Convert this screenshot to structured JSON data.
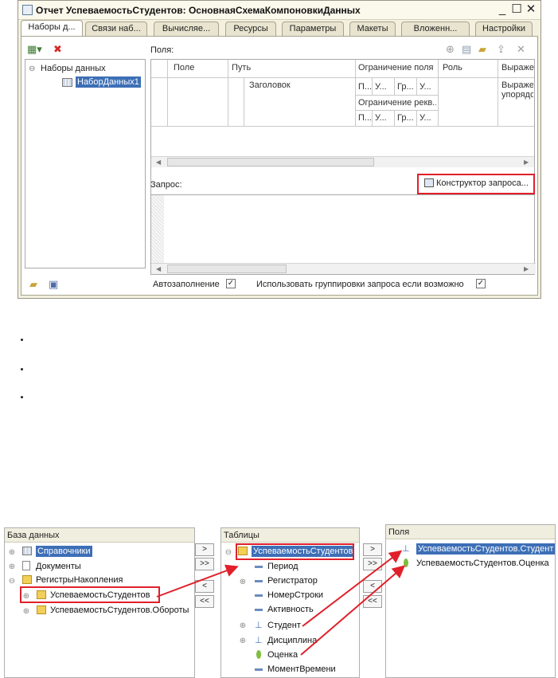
{
  "window": {
    "title": "Отчет УспеваемостьСтудентов: ОсновнаяСхемаКомпоновкиДанных",
    "controls": {
      "minimize": "_",
      "maximize": "☐",
      "close": "✕"
    }
  },
  "tabs": [
    "Наборы д...",
    "Связи наб...",
    "Вычисляе...",
    "Ресурсы",
    "Параметры",
    "Макеты",
    "Вложенн...",
    "Настройки"
  ],
  "tree": {
    "root": "Наборы данных",
    "child": "НаборДанных1"
  },
  "fields": {
    "label": "Поля:",
    "columns": [
      "Поле",
      "Путь",
      "Ограничение поля",
      "Роль",
      "Выраже"
    ],
    "path_value": "Заголовок",
    "restriction_cells": [
      "П...",
      "У...",
      "Гр...",
      "У..."
    ],
    "restriction_req": "Ограничение рекв...",
    "expr_value": "Выраже упорядо"
  },
  "query": {
    "label": "Запрос:",
    "builder_button": "Конструктор запроса..."
  },
  "bottom_bar": {
    "autofill": "Автозаполнение",
    "use_grouping": "Использовать группировки запроса если возможно"
  },
  "builder": {
    "db_header": "База данных",
    "db_items": [
      "Справочники",
      "Документы",
      "РегистрыНакопления",
      "УспеваемостьСтудентов",
      "УспеваемостьСтудентов.Обороты"
    ],
    "tables_header": "Таблицы",
    "table_root": "УспеваемостьСтудентов",
    "table_fields": [
      "Период",
      "Регистратор",
      "НомерСтроки",
      "Активность",
      "Студент",
      "Дисциплина",
      "Оценка",
      "МоментВремени"
    ],
    "fields_header": "Поля",
    "selected_fields": [
      "УспеваемостьСтудентов.Студент",
      "УспеваемостьСтудентов.Оценка"
    ],
    "move_buttons": [
      ">",
      ">>",
      "<",
      "<<"
    ]
  },
  "colors": {
    "selection": "#3d6fb6",
    "highlight": "#e0202a"
  }
}
